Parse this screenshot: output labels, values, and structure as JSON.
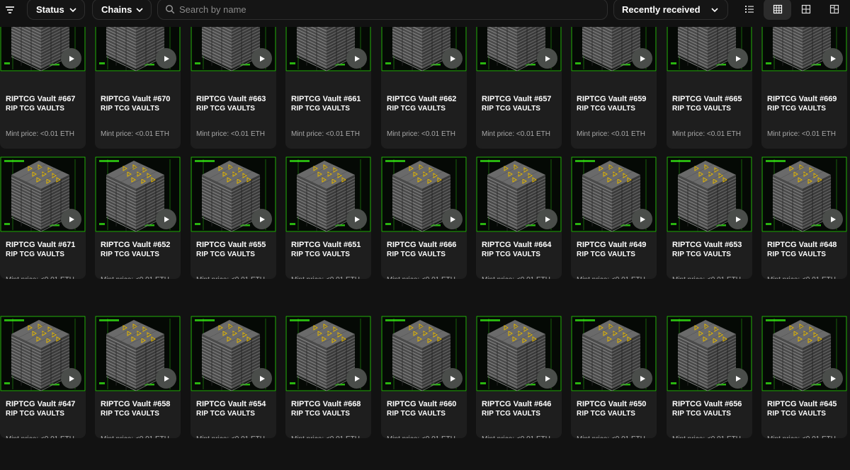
{
  "toolbar": {
    "filter_icon": "filter-lines-icon",
    "status_label": "Status",
    "chains_label": "Chains",
    "search_placeholder": "Search by name",
    "sort_label": "Recently received",
    "view_modes": [
      "list-icon",
      "grid-dense-icon",
      "grid-icon",
      "grid-large-icon"
    ],
    "active_view": 1
  },
  "colors": {
    "background": "#121212",
    "card": "#1e1e1e",
    "accent_green": "#39ff14",
    "accent_yellow": "#e0b400"
  },
  "collection_name": "RIP TCG VAULTS",
  "price_text": "Mint price: <0.01 ETH",
  "rows": [
    [
      "RIPTCG Vault #667",
      "RIPTCG Vault #670",
      "RIPTCG Vault #663",
      "RIPTCG Vault #661",
      "RIPTCG Vault #662",
      "RIPTCG Vault #657",
      "RIPTCG Vault #659",
      "RIPTCG Vault #665",
      "RIPTCG Vault #669"
    ],
    [
      "RIPTCG Vault #671",
      "RIPTCG Vault #652",
      "RIPTCG Vault #655",
      "RIPTCG Vault #651",
      "RIPTCG Vault #666",
      "RIPTCG Vault #664",
      "RIPTCG Vault #649",
      "RIPTCG Vault #653",
      "RIPTCG Vault #648"
    ],
    [
      "RIPTCG Vault #647",
      "RIPTCG Vault #658",
      "RIPTCG Vault #654",
      "RIPTCG Vault #668",
      "RIPTCG Vault #660",
      "RIPTCG Vault #646",
      "RIPTCG Vault #650",
      "RIPTCG Vault #656",
      "RIPTCG Vault #645"
    ]
  ]
}
